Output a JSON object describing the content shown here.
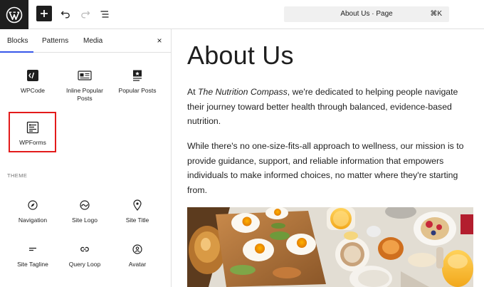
{
  "topbar": {
    "logo_icon": "wordpress-logo-icon",
    "add_icon": "plus-icon",
    "undo_icon": "undo-icon",
    "redo_icon": "redo-icon",
    "list_view_icon": "list-view-icon",
    "command_title": "About Us · Page",
    "command_shortcut": "⌘K"
  },
  "sidebar": {
    "tabs": [
      {
        "label": "Blocks",
        "active": true
      },
      {
        "label": "Patterns",
        "active": false
      },
      {
        "label": "Media",
        "active": false
      }
    ],
    "close_label": "×",
    "blocks": [
      {
        "label": "WPCode",
        "icon": "wpcode-icon"
      },
      {
        "label": "Inline Popular Posts",
        "icon": "inline-posts-icon"
      },
      {
        "label": "Popular Posts",
        "icon": "popular-posts-icon"
      },
      {
        "label": "WPForms",
        "icon": "wpforms-icon",
        "highlighted": true
      }
    ],
    "theme_section_label": "THEME",
    "theme_blocks": [
      {
        "label": "Navigation",
        "icon": "navigation-icon"
      },
      {
        "label": "Site Logo",
        "icon": "site-logo-icon"
      },
      {
        "label": "Site Title",
        "icon": "map-pin-icon"
      },
      {
        "label": "Site Tagline",
        "icon": "tagline-icon"
      },
      {
        "label": "Query Loop",
        "icon": "loop-icon"
      },
      {
        "label": "Avatar",
        "icon": "avatar-icon"
      }
    ]
  },
  "content": {
    "title": "About Us",
    "p1_prefix": "At ",
    "p1_italic": "The Nutrition Compass",
    "p1_rest": ", we're dedicated to helping people navigate their journey toward better health through balanced, evidence-based nutrition.",
    "p2": "While there's no one-size-fits-all approach to wellness, our mission is to provide guidance, support, and reliable information that empowers individuals to make informed choices, no matter where they're starting from.",
    "image_subject": "breakfast-table-photo"
  },
  "colors": {
    "accent": "#3858e9",
    "highlight": "#e31b1b",
    "dark": "#1e1e1e"
  }
}
